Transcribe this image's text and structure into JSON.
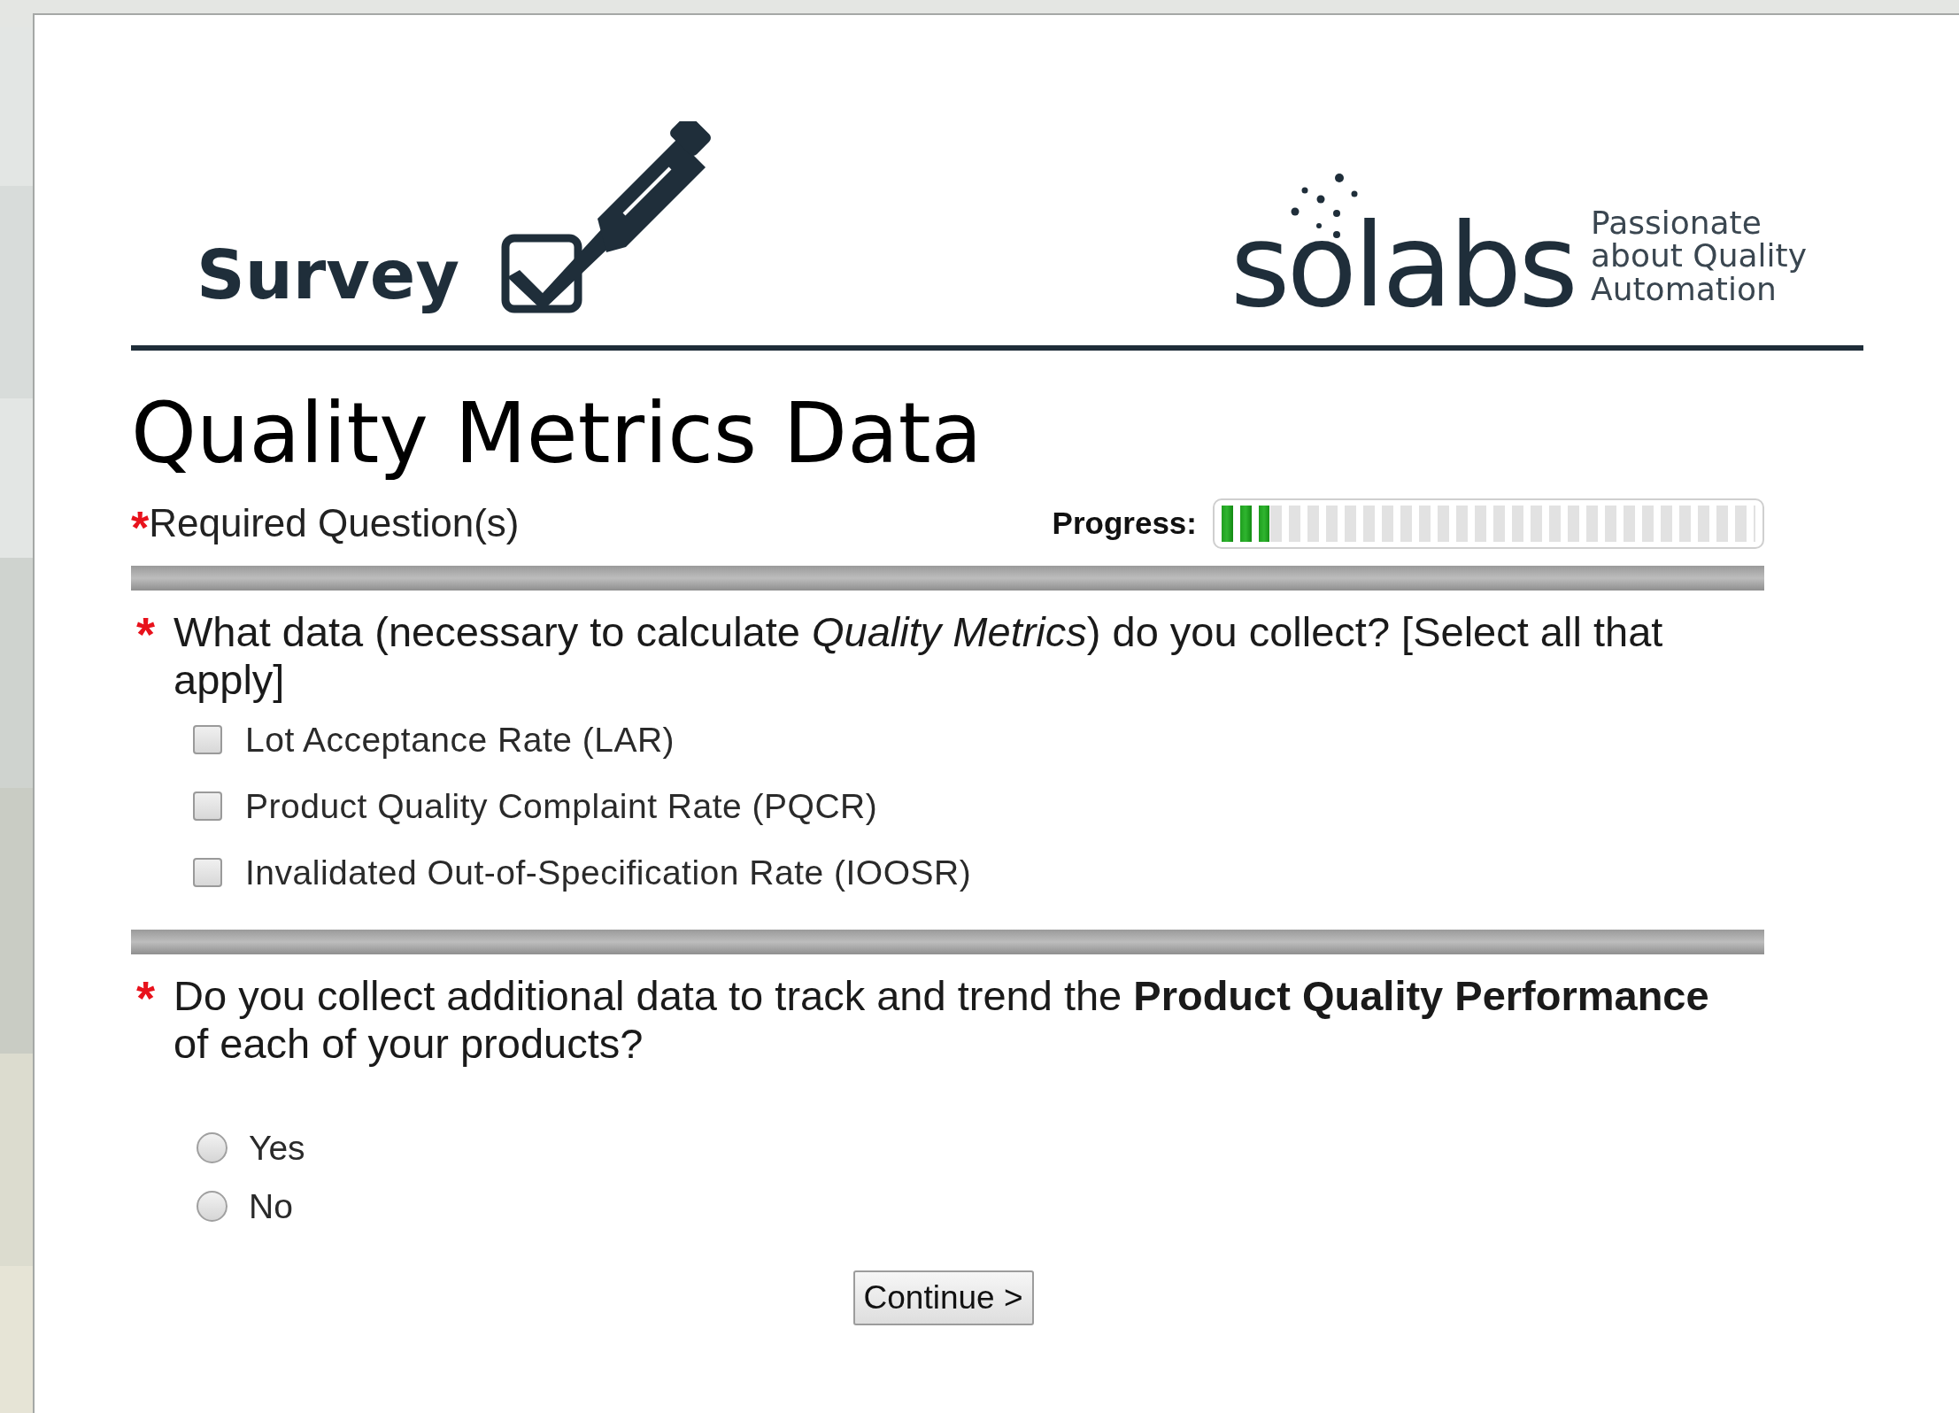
{
  "header": {
    "brand_title": "Survey",
    "wordmark": "solabs",
    "tagline": [
      "Passionate",
      "about Quality",
      "Automation"
    ]
  },
  "title": "Quality Metrics Data",
  "required_note": {
    "marker": "*",
    "text": "Required Question(s)"
  },
  "progress": {
    "label": "Progress:",
    "level": 0.1
  },
  "questions": [
    {
      "kind": "checkbox",
      "marker": "*",
      "text": "What data (necessary to calculate *Quality Metrics*) do you collect? [Select all that apply]",
      "options": [
        {
          "label": "Lot Acceptance Rate (LAR)",
          "checked": false
        },
        {
          "label": "Product Quality Complaint Rate (PQCR)",
          "checked": false
        },
        {
          "label": "Invalidated Out-of-Specification Rate (IOOSR)",
          "checked": false
        }
      ]
    },
    {
      "kind": "radio",
      "marker": "*",
      "text": "Do you collect additional data to track and trend the **Product Quality Performance** of each of your products?",
      "options": [
        {
          "label": "Yes",
          "selected": false
        },
        {
          "label": "No",
          "selected": false
        }
      ]
    }
  ],
  "continue_button": "Continue >"
}
